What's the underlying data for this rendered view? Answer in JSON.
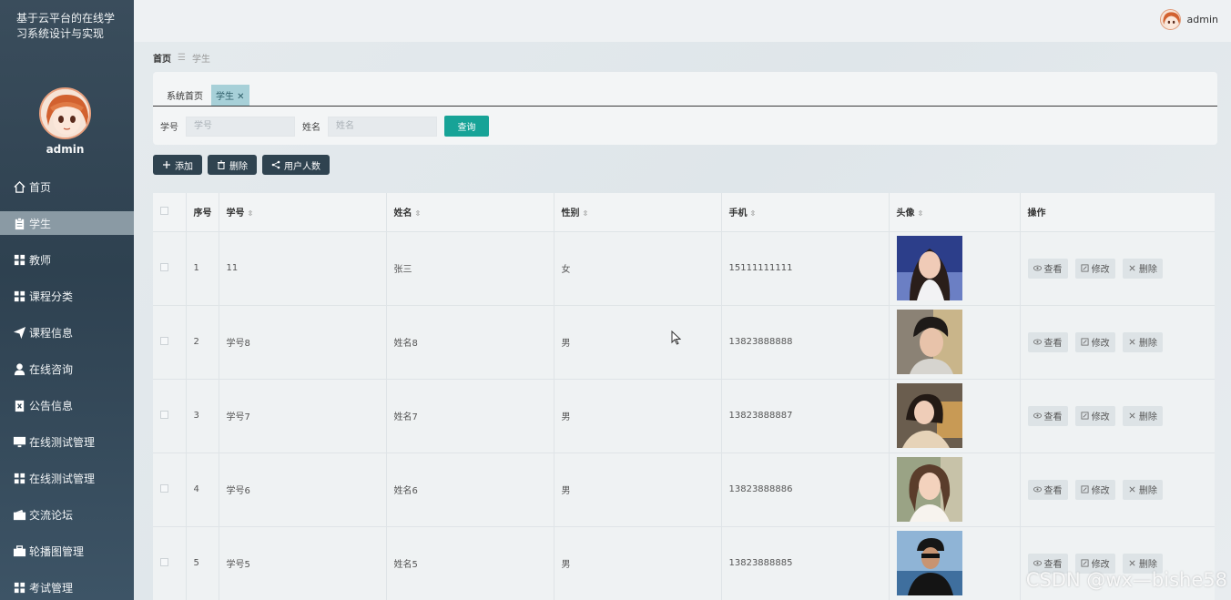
{
  "sidebar": {
    "system_title": "基于云平台的在线学习系统设计与实现",
    "admin_name": "admin",
    "items": [
      {
        "label": "首页",
        "icon": "home-icon"
      },
      {
        "label": "学生",
        "icon": "clipboard-icon",
        "active": true
      },
      {
        "label": "教师",
        "icon": "grid-icon"
      },
      {
        "label": "课程分类",
        "icon": "grid-icon"
      },
      {
        "label": "课程信息",
        "icon": "send-icon"
      },
      {
        "label": "在线咨询",
        "icon": "user-icon"
      },
      {
        "label": "公告信息",
        "icon": "document-x-icon"
      },
      {
        "label": "在线测试管理",
        "icon": "monitor-icon"
      },
      {
        "label": "在线测试管理",
        "icon": "grid-icon"
      },
      {
        "label": "交流论坛",
        "icon": "wallet-icon"
      },
      {
        "label": "轮播图管理",
        "icon": "briefcase-icon"
      },
      {
        "label": "考试管理",
        "icon": "grid-icon"
      }
    ]
  },
  "header": {
    "username": "admin"
  },
  "breadcrumb": {
    "home": "首页",
    "current": "学生"
  },
  "tags": {
    "home": "系统首页",
    "current": "学生"
  },
  "search": {
    "label_no": "学号",
    "placeholder_no": "学号",
    "label_name": "姓名",
    "placeholder_name": "姓名",
    "button": "查询"
  },
  "actions": {
    "add": "添加",
    "delete": "删除",
    "stats": "用户人数"
  },
  "table": {
    "headers": {
      "index": "序号",
      "no": "学号",
      "name": "姓名",
      "gender": "性别",
      "phone": "手机",
      "avatar": "头像",
      "ops": "操作"
    },
    "ops": {
      "view": "查看",
      "edit": "修改",
      "delete": "删除"
    },
    "rows": [
      {
        "index": "1",
        "no": "11",
        "name": "张三",
        "gender": "女",
        "phone": "15111111111"
      },
      {
        "index": "2",
        "no": "学号8",
        "name": "姓名8",
        "gender": "男",
        "phone": "13823888888"
      },
      {
        "index": "3",
        "no": "学号7",
        "name": "姓名7",
        "gender": "男",
        "phone": "13823888887"
      },
      {
        "index": "4",
        "no": "学号6",
        "name": "姓名6",
        "gender": "男",
        "phone": "13823888886"
      },
      {
        "index": "5",
        "no": "学号5",
        "name": "姓名5",
        "gender": "男",
        "phone": "13823888885"
      }
    ]
  },
  "watermark": "CSDN @wx—bishe58",
  "colors": {
    "sidebar": "#2e4150",
    "accent": "#17a397",
    "tag_active": "#a7d0d8"
  }
}
